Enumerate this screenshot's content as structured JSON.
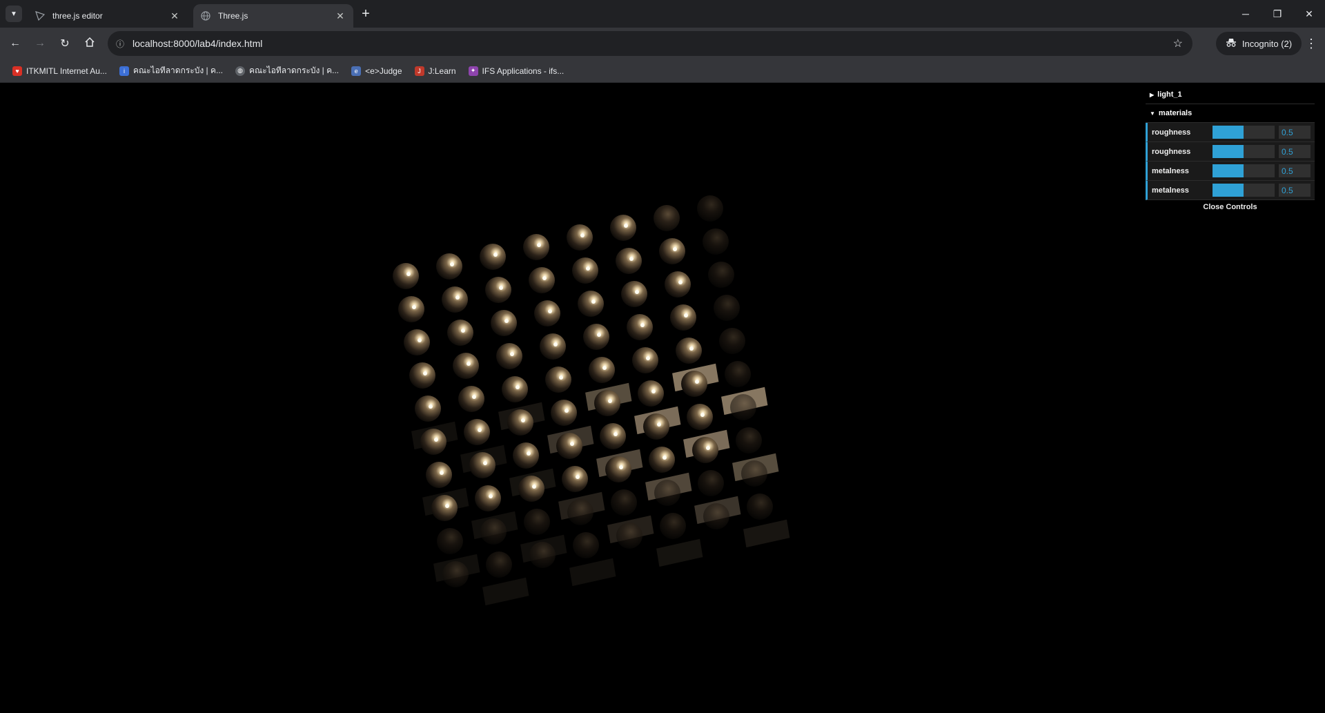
{
  "browser": {
    "tabs": [
      {
        "title": "three.js editor",
        "active": false,
        "icon": "threejs-logo-icon"
      },
      {
        "title": "Three.js",
        "active": true,
        "icon": "globe-icon"
      }
    ],
    "url": "localhost:8000/lab4/index.html",
    "incognito_label": "Incognito (2)",
    "bookmarks": [
      {
        "label": "ITKMITL Internet Au...",
        "icon": "shield-icon",
        "color": "#d93025"
      },
      {
        "label": "คณะไอทีลาดกระบัง | ค...",
        "icon": "it-logo-icon",
        "color": "#3c6fd6"
      },
      {
        "label": "คณะไอทีลาดกระบัง | ค...",
        "icon": "globe-icon",
        "color": "#5f6368"
      },
      {
        "label": "<e>Judge",
        "icon": "judge-icon",
        "color": "#4a6fb5"
      },
      {
        "label": "J:Learn",
        "icon": "jlearn-icon",
        "color": "#c0392b"
      },
      {
        "label": "IFS Applications - ifs...",
        "icon": "ifs-icon",
        "color": "#8e44ad"
      }
    ]
  },
  "gui": {
    "folders": [
      {
        "label": "light_1",
        "open": false
      },
      {
        "label": "materials",
        "open": true
      }
    ],
    "controls": [
      {
        "label": "roughness",
        "value": "0.5",
        "fraction": 0.5
      },
      {
        "label": "roughness",
        "value": "0.5",
        "fraction": 0.5
      },
      {
        "label": "metalness",
        "value": "0.5",
        "fraction": 0.5
      },
      {
        "label": "metalness",
        "value": "0.5",
        "fraction": 0.5
      }
    ],
    "close_label": "Close Controls",
    "accent": "#2fa1d6"
  }
}
